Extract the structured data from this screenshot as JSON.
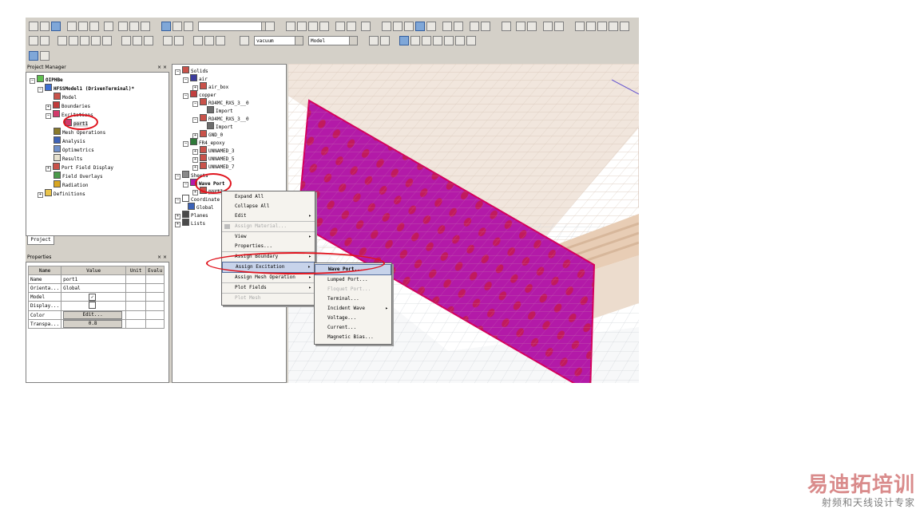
{
  "toolbar": {
    "material_select": "vacuum",
    "model_select": "Model"
  },
  "project_manager": {
    "title": "Project Manager",
    "project_tab": "Project",
    "tree": [
      {
        "label": "OIPHBe"
      },
      {
        "label": "HFSSModel1 (DrivenTerminal)*"
      },
      {
        "label": "Model"
      },
      {
        "label": "Boundaries"
      },
      {
        "label": "Excitations"
      },
      {
        "label": "port1"
      },
      {
        "label": "Mesh Operations"
      },
      {
        "label": "Analysis"
      },
      {
        "label": "Optimetrics"
      },
      {
        "label": "Results"
      },
      {
        "label": "Port Field Display"
      },
      {
        "label": "Field Overlays"
      },
      {
        "label": "Radiation"
      },
      {
        "label": "Definitions"
      }
    ]
  },
  "properties": {
    "title": "Properties",
    "columns": [
      "Name",
      "Value",
      "Unit",
      "Evalu"
    ],
    "rows": [
      {
        "name": "Name",
        "value": "port1"
      },
      {
        "name": "Orienta...",
        "value": "Global"
      },
      {
        "name": "Model",
        "value": "✓"
      },
      {
        "name": "Display...",
        "value": ""
      },
      {
        "name": "Color",
        "value": "Edit..."
      },
      {
        "name": "Transpa...",
        "value": "0.8"
      }
    ]
  },
  "model_tree": [
    {
      "label": "Solids"
    },
    {
      "label": "air"
    },
    {
      "label": "air_box"
    },
    {
      "label": "copper"
    },
    {
      "label": "RO4MC_RXS_3__0"
    },
    {
      "label": "Import"
    },
    {
      "label": "RO4MC_RXS_3__0"
    },
    {
      "label": "Import"
    },
    {
      "label": "GND_0"
    },
    {
      "label": "FR4_epoxy"
    },
    {
      "label": "UNNAMED_3"
    },
    {
      "label": "UNNAMED_5"
    },
    {
      "label": "UNNAMED_7"
    },
    {
      "label": "Sheets"
    },
    {
      "label": "Wave Port"
    },
    {
      "label": "port1"
    },
    {
      "label": "Coordinate Systems"
    },
    {
      "label": "Global"
    },
    {
      "label": "Planes"
    },
    {
      "label": "Lists"
    }
  ],
  "context_menu": [
    {
      "label": "Expand All",
      "submenu": false,
      "disabled": false
    },
    {
      "label": "Collapse All",
      "submenu": false,
      "disabled": false
    },
    {
      "label": "Edit",
      "submenu": true,
      "disabled": false
    },
    {
      "label": "Assign Material...",
      "submenu": false,
      "disabled": true
    },
    {
      "label": "View",
      "submenu": true,
      "disabled": false
    },
    {
      "label": "Properties...",
      "submenu": false,
      "disabled": false
    },
    {
      "label": "Assign Boundary",
      "submenu": true,
      "disabled": false
    },
    {
      "label": "Assign Excitation",
      "submenu": true,
      "disabled": false,
      "highlighted": true
    },
    {
      "label": "Assign Mesh Operation",
      "submenu": true,
      "disabled": false
    },
    {
      "label": "Plot Fields",
      "submenu": true,
      "disabled": false
    },
    {
      "label": "Plot Mesh",
      "submenu": false,
      "disabled": true
    }
  ],
  "excitation_submenu": [
    {
      "label": "Wave Port...",
      "submenu": false,
      "disabled": false,
      "highlighted": true
    },
    {
      "label": "Lumped Port...",
      "submenu": false,
      "disabled": false
    },
    {
      "label": "Floquet Port...",
      "submenu": false,
      "disabled": true
    },
    {
      "label": "Terminal...",
      "submenu": false,
      "disabled": false
    },
    {
      "label": "Incident Wave",
      "submenu": true,
      "disabled": false
    },
    {
      "label": "Voltage...",
      "submenu": false,
      "disabled": false
    },
    {
      "label": "Current...",
      "submenu": false,
      "disabled": false
    },
    {
      "label": "Magnetic Bias...",
      "submenu": false,
      "disabled": false
    }
  ],
  "watermark": {
    "brand": "易迪拓培训",
    "tagline": "射频和天线设计专家"
  },
  "colors": {
    "port_face": "#b31aa8",
    "highlight_ring": "#e0141e",
    "menu_highlight": "#c7d3ea"
  }
}
